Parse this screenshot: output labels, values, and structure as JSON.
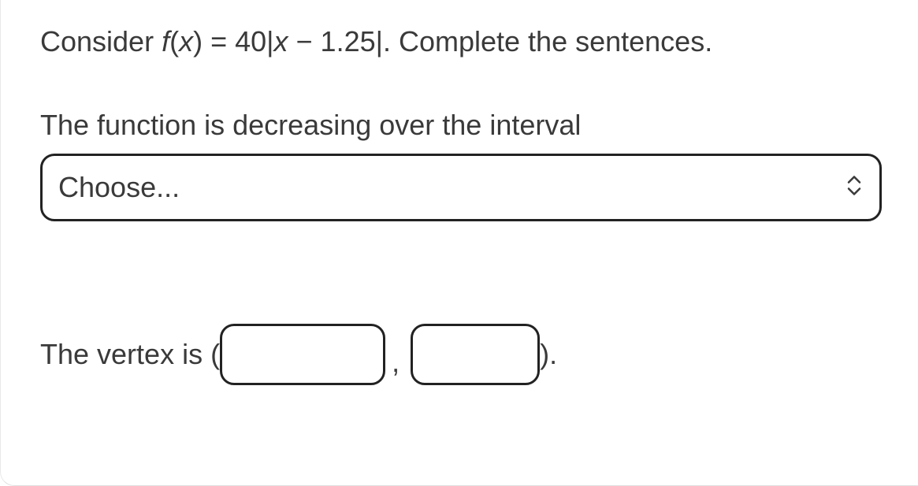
{
  "problem": {
    "prefix": "Consider ",
    "fn_f": "f",
    "paren_open": "(",
    "fn_x": "x",
    "paren_close": ")",
    "equals": " = 40|",
    "var_x": "x",
    "rest": " − 1.25|. Complete the sentences."
  },
  "interval_label": "The function is decreasing over the interval",
  "select": {
    "placeholder": "Choose..."
  },
  "vertex": {
    "prefix": "The vertex is (",
    "comma": ",",
    "suffix": ")."
  }
}
